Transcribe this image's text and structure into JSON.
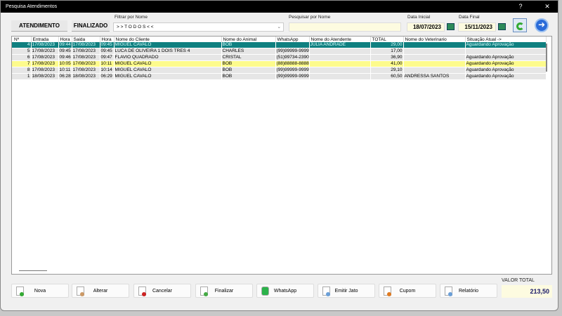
{
  "window": {
    "title": "Pesquisa Atendimentos",
    "help": "?",
    "close": "✕"
  },
  "toolbar": {
    "atendimento": "ATENDIMENTO",
    "finalizado": "FINALIZADO",
    "filter_label": "Filtrar por Nome",
    "filter_value": "> > T O D O S < <",
    "search_label": "Pesquisar por Nome",
    "search_value": "",
    "date_start_label": "Data Inicial",
    "date_start": "18/07/2023",
    "date_end_label": "Data Final",
    "date_end": "15/11/2023"
  },
  "grid": {
    "headers": [
      "Nº",
      "Entrada",
      "Hora",
      "Saida",
      "Hora",
      "Nome do Cliente",
      "Nome do Animal",
      "WhatsApp",
      "Nome do Atendente",
      "TOTAL",
      "Nome do Veterinario",
      "Situação Atual ->"
    ],
    "rows": [
      [
        "4",
        "17/08/2023",
        "09:44",
        "17/08/2023",
        "09:45",
        "MIGUEL CAVALO",
        "BOB",
        "",
        "JULIA ANDRADE",
        "29,00",
        "",
        "Aguardando Aprovação"
      ],
      [
        "5",
        "17/08/2023",
        "09:45",
        "17/08/2023",
        "09:45",
        "LUCA DE OLIVEIRA 1 DOIS TRES 4",
        "CHARLES",
        "(99)99999-9999",
        "",
        "17,00",
        "",
        ""
      ],
      [
        "6",
        "17/08/2023",
        "09:46",
        "17/08/2023",
        "09:47",
        "FLAVIO QUADRADO",
        "CRISTAL",
        "(51)99734-2390",
        "",
        "36,90",
        "",
        "Aguardando Aprovação"
      ],
      [
        "7",
        "17/08/2023",
        "10:05",
        "17/08/2023",
        "10:11",
        "MIGUEL CAVALO",
        "BOB",
        "(88)88888-8888",
        "",
        "41,00",
        "",
        "Aguardando Aprovação"
      ],
      [
        "8",
        "17/08/2023",
        "10:11",
        "17/08/2023",
        "10:14",
        "MIGUEL CAVALO",
        "BOB",
        "(99)99999-9999",
        "",
        "29,10",
        "",
        "Aguardando Aprovação"
      ],
      [
        "1",
        "18/08/2023",
        "06:28",
        "18/08/2023",
        "06:29",
        "MIGUEL CAVALO",
        "BOB",
        "(99)99999-9999",
        "",
        "60,50",
        "ANDRESSA SANTOS",
        "Aguardando Aprovação"
      ]
    ]
  },
  "buttons": [
    "Nova",
    "Alterar",
    "Cancelar",
    "Finalizar",
    "WhatsApp",
    "Emitir Jato",
    "Cupom",
    "Relatório"
  ],
  "total": {
    "label": "VALOR TOTAL",
    "value": "213,50"
  }
}
